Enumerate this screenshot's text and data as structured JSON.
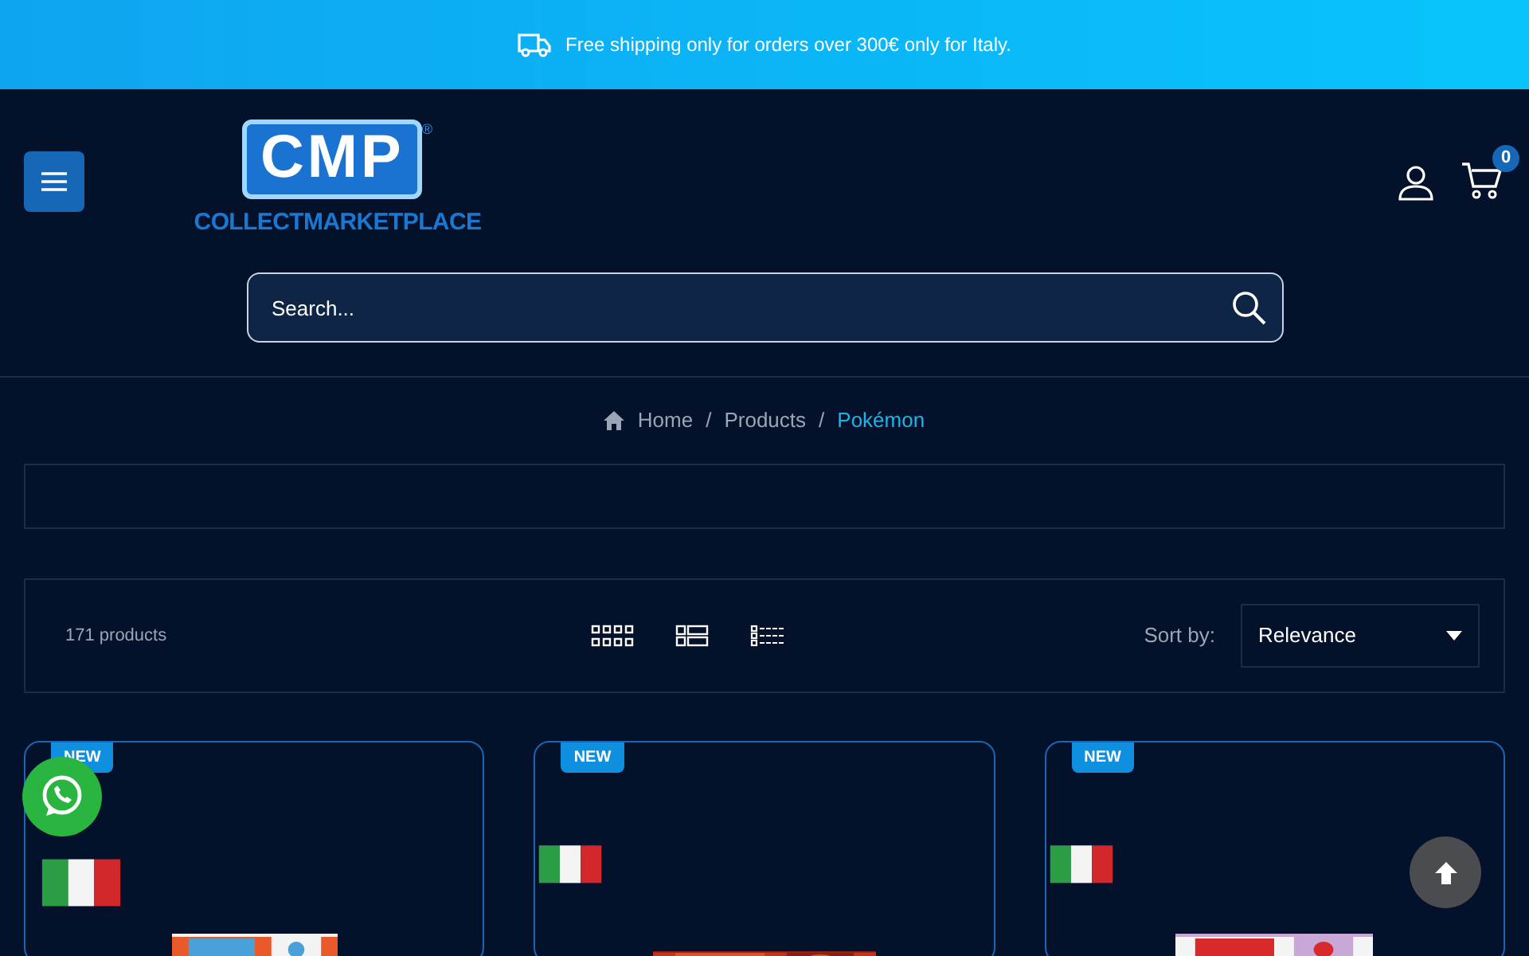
{
  "banner": {
    "text": "Free shipping only for orders over 300€ only for Italy."
  },
  "logo": {
    "letters": "CMP",
    "mark": "®",
    "name": "COLLECTMARKETPLACE"
  },
  "cart": {
    "count": "0"
  },
  "search": {
    "placeholder": "Search..."
  },
  "breadcrumb": [
    {
      "label": "Home",
      "selected": false
    },
    {
      "separator": "/",
      "label": "Products",
      "selected": false
    },
    {
      "separator": "/",
      "label": "Pokémon",
      "selected": true
    }
  ],
  "toolbar": {
    "count": "171 products",
    "sort_label": "Sort by:",
    "sort_value": "Relevance"
  },
  "products": [
    {
      "badge": "NEW"
    },
    {
      "badge": "NEW"
    },
    {
      "badge": "NEW"
    }
  ]
}
